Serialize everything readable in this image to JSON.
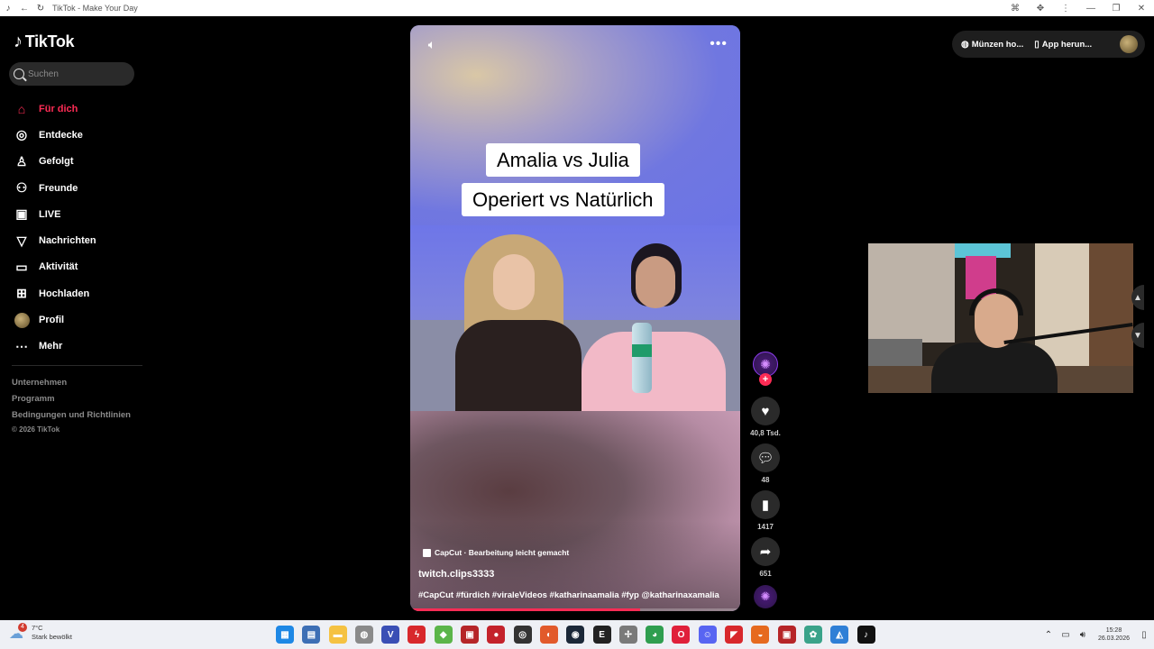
{
  "window": {
    "title": "TikTok - Make Your Day",
    "icons": [
      "tiktok-logo-icon",
      "back-arrow-icon",
      "reload-icon",
      "translate-icon",
      "extensions-icon",
      "kebab-menu-icon",
      "minimize-icon",
      "restore-icon",
      "close-icon"
    ]
  },
  "sidebar": {
    "logo": "TikTok",
    "search_placeholder": "Suchen",
    "items": [
      {
        "label": "Für dich",
        "icon": "home-icon",
        "active": true
      },
      {
        "label": "Entdecke",
        "icon": "compass-icon",
        "active": false
      },
      {
        "label": "Gefolgt",
        "icon": "user-follow-icon",
        "active": false
      },
      {
        "label": "Freunde",
        "icon": "friends-icon",
        "active": false
      },
      {
        "label": "LIVE",
        "icon": "live-tv-icon",
        "active": false
      },
      {
        "label": "Nachrichten",
        "icon": "send-icon",
        "active": false
      },
      {
        "label": "Aktivität",
        "icon": "activity-icon",
        "active": false
      },
      {
        "label": "Hochladen",
        "icon": "upload-plus-icon",
        "active": false
      },
      {
        "label": "Profil",
        "icon": "profile-avatar",
        "active": false
      },
      {
        "label": "Mehr",
        "icon": "more-dots-icon",
        "active": false
      }
    ],
    "footer": [
      "Unternehmen",
      "Programm",
      "Bedingungen und Richtlinien"
    ],
    "copyright": "© 2026 TikTok"
  },
  "video": {
    "caption_line1": "Amalia vs Julia",
    "caption_line2": "Operiert vs Natürlich",
    "capcut_label": "CapCut · Bearbeitung leicht gemacht",
    "author": "twitch.clips3333",
    "hashtags": "#CapCut #fürdich #viraleVideos #katharinaamalia #fyp @katharinaxamalia",
    "progress": 0.7
  },
  "actions": {
    "likes": "40,8 Tsd.",
    "comments": "48",
    "saves": "1417",
    "shares": "651"
  },
  "topbar": {
    "coins_label": "Münzen ho...",
    "app_label": "App herun..."
  },
  "taskbar": {
    "weather_temp": "7°C",
    "weather_desc": "Stark bewölkt",
    "weather_badge": "4",
    "time": "15:28",
    "date": "26.03.2026",
    "apps": [
      {
        "name": "windows-start-icon",
        "color": "#1e88e5",
        "glyph": "▦"
      },
      {
        "name": "calculator-icon",
        "color": "#3d6fb5",
        "glyph": "▤"
      },
      {
        "name": "file-explorer-icon",
        "color": "#f5c242",
        "glyph": "▬"
      },
      {
        "name": "mouse-app-icon",
        "color": "#8a8a8a",
        "glyph": "◍"
      },
      {
        "name": "vegas-icon",
        "color": "#3a4fb5",
        "glyph": "V"
      },
      {
        "name": "app-red-icon",
        "color": "#d8282c",
        "glyph": "ϟ"
      },
      {
        "name": "bluestacks-icon",
        "color": "#5bb54a",
        "glyph": "◆"
      },
      {
        "name": "video-app-icon",
        "color": "#b62528",
        "glyph": "▣"
      },
      {
        "name": "record-app-icon",
        "color": "#c4222b",
        "glyph": "●"
      },
      {
        "name": "obs-icon",
        "color": "#333333",
        "glyph": "◎"
      },
      {
        "name": "ubisoft-icon",
        "color": "#e25a2b",
        "glyph": "◐"
      },
      {
        "name": "steam-icon",
        "color": "#1b2838",
        "glyph": "◉"
      },
      {
        "name": "epic-games-icon",
        "color": "#222222",
        "glyph": "E"
      },
      {
        "name": "pinwheel-icon",
        "color": "#7a7a7a",
        "glyph": "✢"
      },
      {
        "name": "chrome-icon",
        "color": "#2f9e4f",
        "glyph": "◕"
      },
      {
        "name": "opera-icon",
        "color": "#e0203a",
        "glyph": "O"
      },
      {
        "name": "discord-icon",
        "color": "#5865f2",
        "glyph": "☺"
      },
      {
        "name": "app-red2-icon",
        "color": "#d8282c",
        "glyph": "◤"
      },
      {
        "name": "firefox-icon",
        "color": "#e66a1f",
        "glyph": "◒"
      },
      {
        "name": "media-app-icon",
        "color": "#b62528",
        "glyph": "▣"
      },
      {
        "name": "app-teal-icon",
        "color": "#3aa38a",
        "glyph": "✿"
      },
      {
        "name": "maps-icon",
        "color": "#2f7fd6",
        "glyph": "◭"
      },
      {
        "name": "tiktok-taskbar-icon",
        "color": "#111111",
        "glyph": "♪"
      }
    ]
  },
  "colors": {
    "accent": "#fe2c55",
    "background": "#000000",
    "panel": "#2a2a2a"
  }
}
